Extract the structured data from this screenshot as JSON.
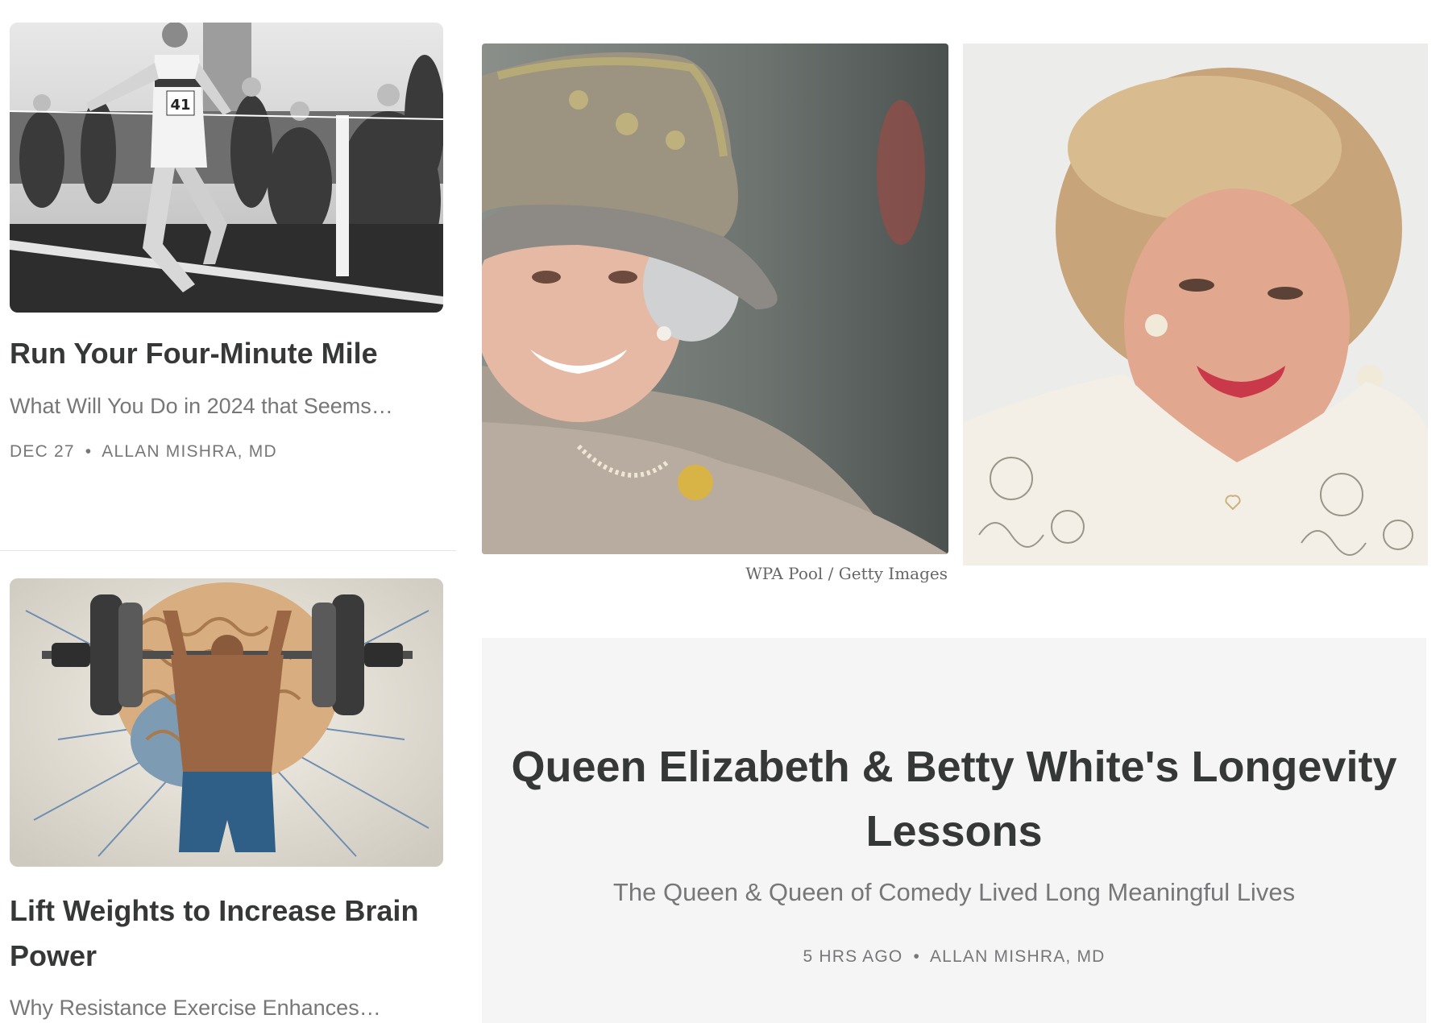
{
  "posts": [
    {
      "image_alt": "runner breaking finish tape, number 41, black and white photo",
      "runner_bib": "41",
      "title": "Run Your Four-Minute Mile",
      "subtitle": "What Will You Do in 2024 that Seems…",
      "date": "DEC 27",
      "author": "ALLAN MISHRA, MD"
    },
    {
      "image_alt": "muscular man lifting barbell in front of a giant brain",
      "title": "Lift Weights to Increase Brain Power",
      "subtitle": "Why Resistance Exercise Enhances…"
    }
  ],
  "feature": {
    "photo_left_alt": "Queen Elizabeth smiling in a tweed hat",
    "photo_right_alt": "Betty White smiling",
    "photo_credit": "WPA Pool / Getty Images",
    "title": "Queen Elizabeth & Betty White's Longevity Lessons",
    "subtitle": "The Queen & Queen of Comedy Lived Long Meaningful Lives",
    "date": "5 HRS AGO",
    "author": "ALLAN MISHRA, MD"
  },
  "meta_separator": "•",
  "colors": {
    "text": "#363737",
    "muted": "#77777a",
    "feature_bg": "#f5f5f5",
    "divider": "#e6e6e6"
  }
}
